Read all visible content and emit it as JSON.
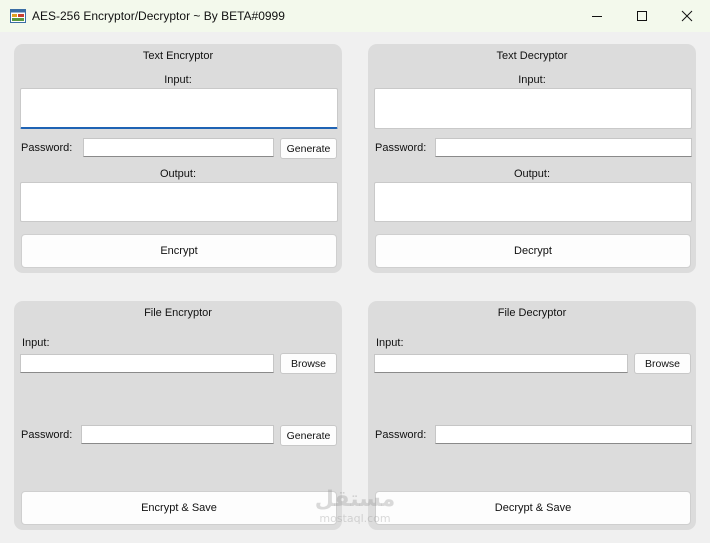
{
  "window": {
    "title": "AES-256 Encryptor/Decryptor  ~  By BETA#0999"
  },
  "text_encryptor": {
    "title": "Text Encryptor",
    "input_label": "Input:",
    "input_value": "",
    "password_label": "Password:",
    "password_value": "",
    "generate_label": "Generate",
    "output_label": "Output:",
    "output_value": "",
    "action_label": "Encrypt"
  },
  "text_decryptor": {
    "title": "Text Decryptor",
    "input_label": "Input:",
    "input_value": "",
    "password_label": "Password:",
    "password_value": "",
    "output_label": "Output:",
    "output_value": "",
    "action_label": "Decrypt"
  },
  "file_encryptor": {
    "title": "File Encryptor",
    "input_label": "Input:",
    "input_value": "",
    "browse_label": "Browse",
    "password_label": "Password:",
    "password_value": "",
    "generate_label": "Generate",
    "action_label": "Encrypt & Save"
  },
  "file_decryptor": {
    "title": "File Decryptor",
    "input_label": "Input:",
    "input_value": "",
    "browse_label": "Browse",
    "password_label": "Password:",
    "password_value": "",
    "action_label": "Decrypt & Save"
  },
  "watermark": {
    "main": "مستقل",
    "sub": "mostaql.com"
  },
  "icons": {
    "app": "app-window-icon",
    "minimize": "minimize-icon",
    "maximize": "maximize-icon",
    "close": "close-icon"
  },
  "colors": {
    "titlebar": "#f3f9ec",
    "panel": "#dcdcdc",
    "focus_accent": "#1f63b4"
  }
}
